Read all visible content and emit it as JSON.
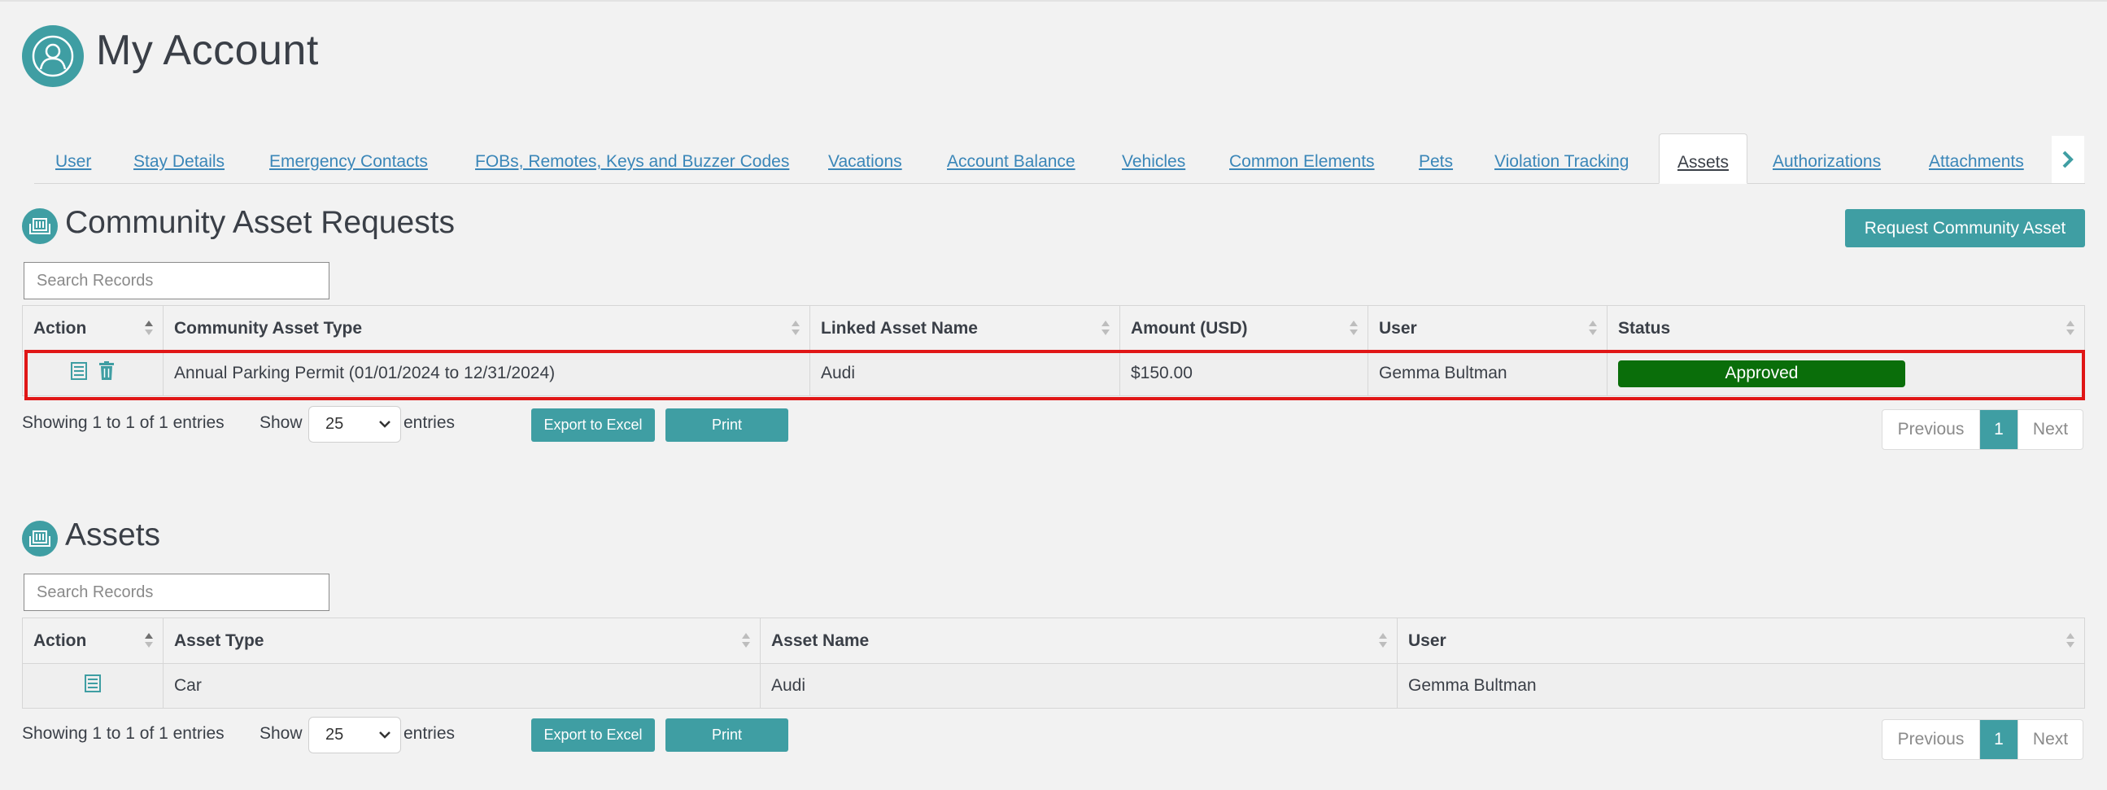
{
  "header": {
    "title": "My Account",
    "avatar_icon": "user-avatar-icon"
  },
  "tabs": [
    {
      "label": "User"
    },
    {
      "label": "Stay Details"
    },
    {
      "label": "Emergency Contacts"
    },
    {
      "label": "FOBs, Remotes, Keys and Buzzer Codes"
    },
    {
      "label": "Vacations"
    },
    {
      "label": "Account Balance"
    },
    {
      "label": "Vehicles"
    },
    {
      "label": "Common Elements"
    },
    {
      "label": "Pets"
    },
    {
      "label": "Violation Tracking"
    },
    {
      "label": "Assets",
      "active": true
    },
    {
      "label": "Authorizations"
    },
    {
      "label": "Attachments"
    }
  ],
  "requests": {
    "title": "Community Asset Requests",
    "request_button": "Request Community Asset",
    "search_placeholder": "Search Records",
    "columns": [
      "Action",
      "Community Asset Type",
      "Linked Asset Name",
      "Amount (USD)",
      "User",
      "Status"
    ],
    "rows": [
      {
        "type": "Annual Parking Permit (01/01/2024 to 12/31/2024)",
        "linked": "Audi",
        "amount": "$150.00",
        "user": "Gemma Bultman",
        "status": "Approved"
      }
    ],
    "showing": "Showing 1 to 1 of 1 entries",
    "show_label": "Show",
    "page_size": "25",
    "entries_label": "entries",
    "export_label": "Export to Excel",
    "print_label": "Print",
    "pager": {
      "previous": "Previous",
      "current": "1",
      "next": "Next"
    }
  },
  "assets": {
    "title": "Assets",
    "search_placeholder": "Search Records",
    "columns": [
      "Action",
      "Asset Type",
      "Asset Name",
      "User"
    ],
    "rows": [
      {
        "type": "Car",
        "name": "Audi",
        "user": "Gemma Bultman"
      }
    ],
    "showing": "Showing 1 to 1 of 1 entries",
    "show_label": "Show",
    "page_size": "25",
    "entries_label": "entries",
    "export_label": "Export to Excel",
    "print_label": "Print",
    "pager": {
      "previous": "Previous",
      "current": "1",
      "next": "Next"
    }
  },
  "colors": {
    "accent": "#3f9ea3",
    "link": "#3a86b8",
    "approved": "#0a6e0a",
    "highlight": "#e01616"
  }
}
